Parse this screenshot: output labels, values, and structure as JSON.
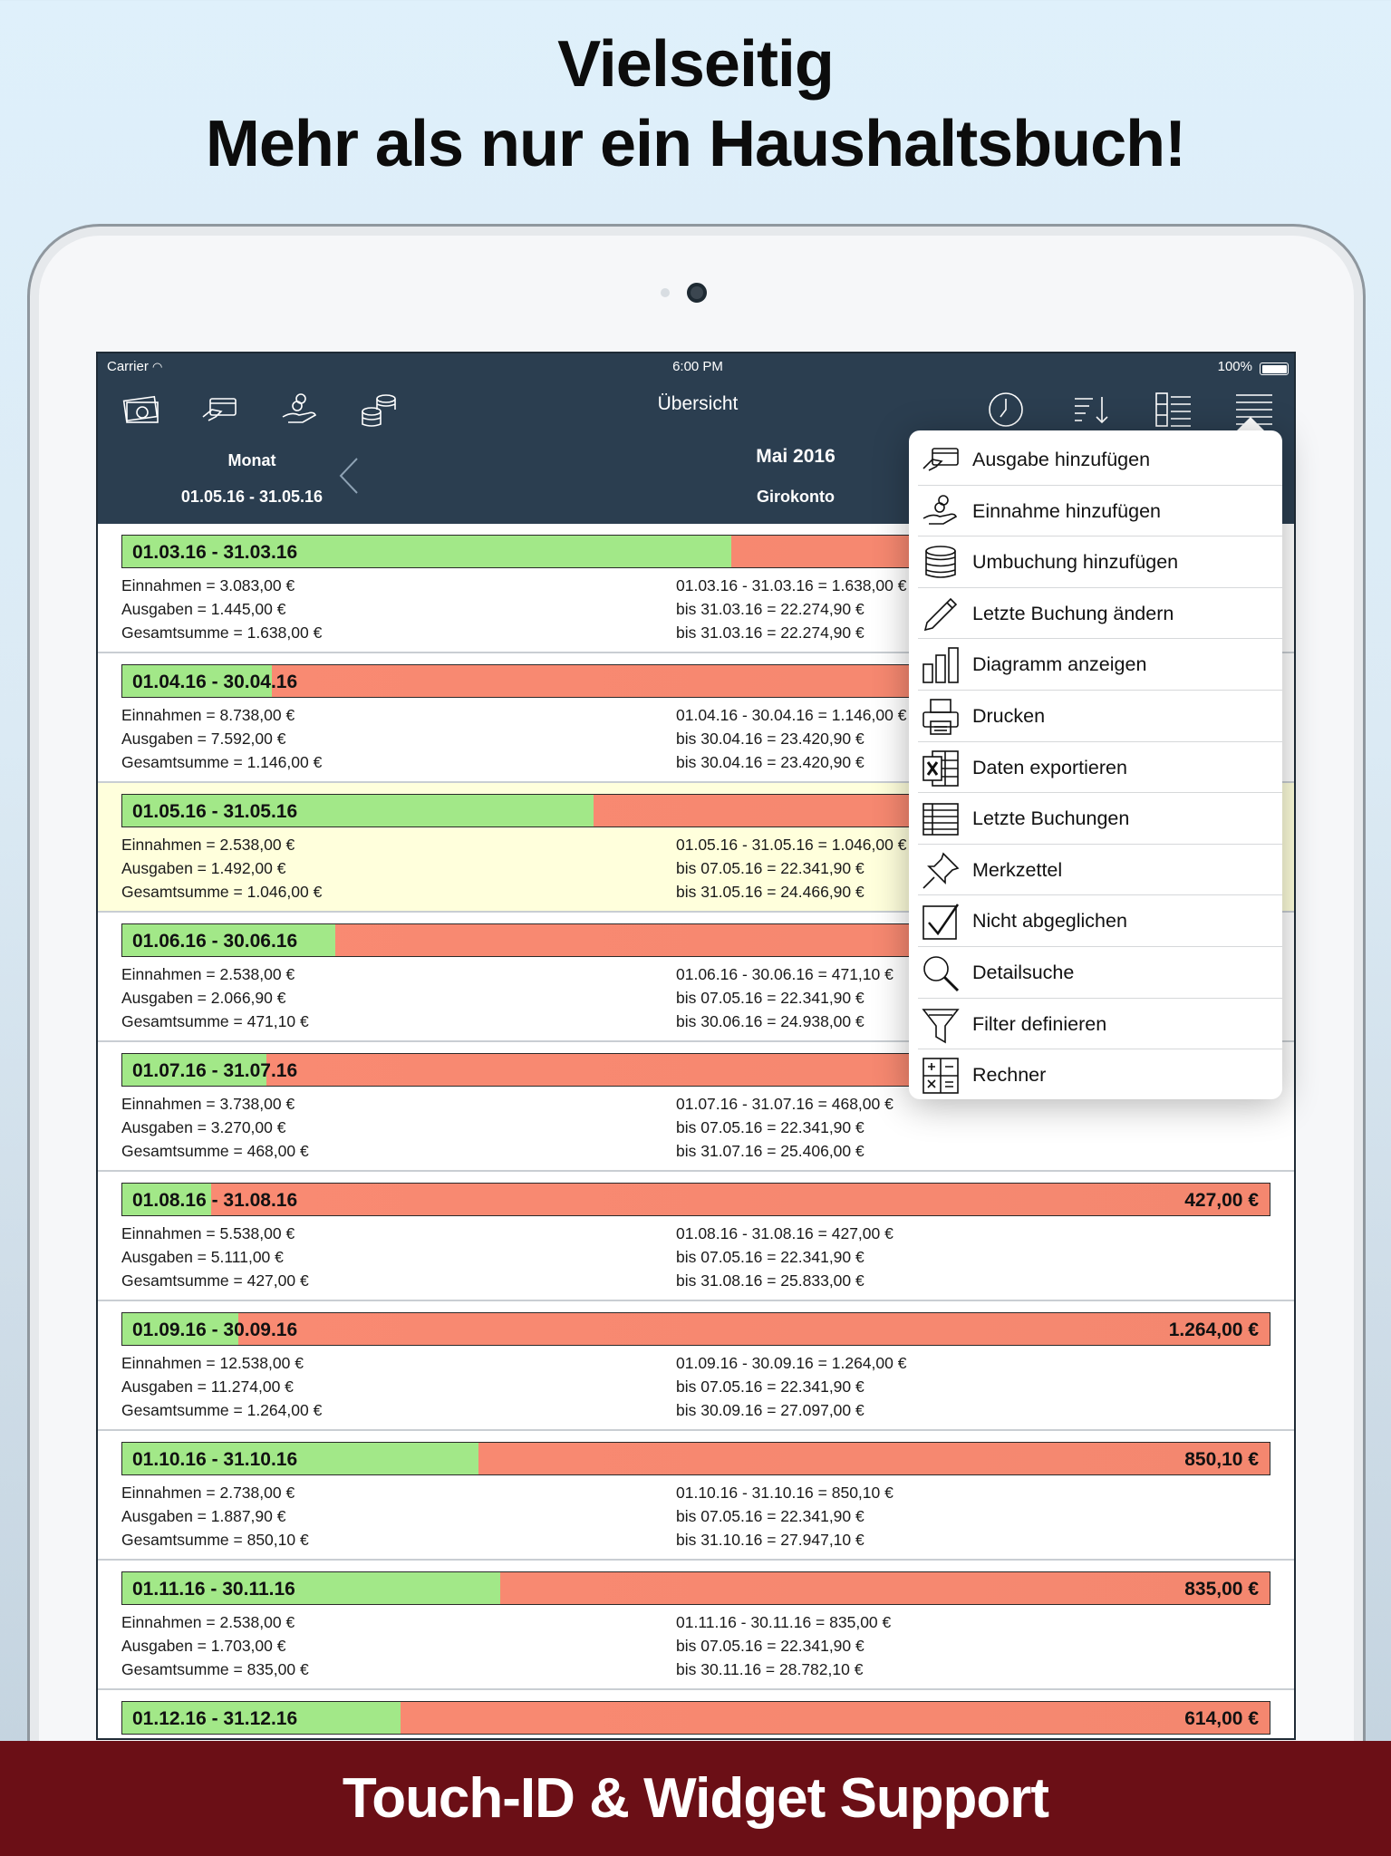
{
  "headline": {
    "line1": "Vielseitig",
    "line2": "Mehr als nur ein Haushaltsbuch!"
  },
  "status_bar": {
    "carrier": "Carrier",
    "time": "6:00 PM",
    "battery": "100%"
  },
  "nav": {
    "title": "Übersicht",
    "left_icons": [
      "money-icon",
      "card-payment-icon",
      "income-hand-icon",
      "coins-stack-icon"
    ],
    "right_icons": [
      "clock-icon",
      "sort-icon",
      "list-detail-icon",
      "menu-icon"
    ]
  },
  "header": {
    "mode": "Monat",
    "range": "01.05.16 - 31.05.16",
    "period": "Mai 2016",
    "account": "Girokonto"
  },
  "rows": [
    {
      "range": "01.03.16 - 31.03.16",
      "green_ratio": 0.53,
      "amount": "",
      "selected": false,
      "einnahmen": "Einnahmen = 3.083,00 €",
      "ausgaben": "Ausgaben = 1.445,00 €",
      "gesamt": "Gesamtsumme = 1.638,00 €",
      "r1": "01.03.16 - 31.03.16 = 1.638,00 €",
      "r2": "bis 31.03.16 = 22.274,90 €",
      "r3": "bis 31.03.16 = 22.274,90 €"
    },
    {
      "range": "01.04.16 - 30.04.16",
      "green_ratio": 0.13,
      "amount": "",
      "selected": false,
      "einnahmen": "Einnahmen = 8.738,00 €",
      "ausgaben": "Ausgaben = 7.592,00 €",
      "gesamt": "Gesamtsumme = 1.146,00 €",
      "r1": "01.04.16 - 30.04.16 = 1.146,00 €",
      "r2": "bis 30.04.16 = 23.420,90 €",
      "r3": "bis 30.04.16 = 23.420,90 €"
    },
    {
      "range": "01.05.16 - 31.05.16",
      "green_ratio": 0.41,
      "amount": "",
      "selected": true,
      "einnahmen": "Einnahmen = 2.538,00 €",
      "ausgaben": "Ausgaben = 1.492,00 €",
      "gesamt": "Gesamtsumme = 1.046,00 €",
      "r1": "01.05.16 - 31.05.16 = 1.046,00 €",
      "r2": "bis 07.05.16 = 22.341,90 €",
      "r3": "bis 31.05.16 = 24.466,90 €"
    },
    {
      "range": "01.06.16 - 30.06.16",
      "green_ratio": 0.185,
      "amount": "",
      "selected": false,
      "einnahmen": "Einnahmen = 2.538,00 €",
      "ausgaben": "Ausgaben = 2.066,90 €",
      "gesamt": "Gesamtsumme = 471,10 €",
      "r1": "01.06.16 - 30.06.16 = 471,10 €",
      "r2": "bis 07.05.16 = 22.341,90 €",
      "r3": "bis 30.06.16 = 24.938,00 €"
    },
    {
      "range": "01.07.16 - 31.07.16",
      "green_ratio": 0.125,
      "amount": "",
      "selected": false,
      "einnahmen": "Einnahmen = 3.738,00 €",
      "ausgaben": "Ausgaben = 3.270,00 €",
      "gesamt": "Gesamtsumme = 468,00 €",
      "r1": "01.07.16 - 31.07.16 = 468,00 €",
      "r2": "bis 07.05.16 = 22.341,90 €",
      "r3": "bis 31.07.16 = 25.406,00 €"
    },
    {
      "range": "01.08.16 - 31.08.16",
      "green_ratio": 0.077,
      "amount": "427,00 €",
      "selected": false,
      "einnahmen": "Einnahmen = 5.538,00 €",
      "ausgaben": "Ausgaben = 5.111,00 €",
      "gesamt": "Gesamtsumme = 427,00 €",
      "r1": "01.08.16 - 31.08.16 = 427,00 €",
      "r2": "bis 07.05.16 = 22.341,90 €",
      "r3": "bis 31.08.16 = 25.833,00 €"
    },
    {
      "range": "01.09.16 - 30.09.16",
      "green_ratio": 0.101,
      "amount": "1.264,00 €",
      "selected": false,
      "einnahmen": "Einnahmen = 12.538,00 €",
      "ausgaben": "Ausgaben = 11.274,00 €",
      "gesamt": "Gesamtsumme = 1.264,00 €",
      "r1": "01.09.16 - 30.09.16 = 1.264,00 €",
      "r2": "bis 07.05.16 = 22.341,90 €",
      "r3": "bis 30.09.16 = 27.097,00 €"
    },
    {
      "range": "01.10.16 - 31.10.16",
      "green_ratio": 0.31,
      "amount": "850,10 €",
      "selected": false,
      "einnahmen": "Einnahmen = 2.738,00 €",
      "ausgaben": "Ausgaben = 1.887,90 €",
      "gesamt": "Gesamtsumme = 850,10 €",
      "r1": "01.10.16 - 31.10.16 = 850,10 €",
      "r2": "bis 07.05.16 = 22.341,90 €",
      "r3": "bis 31.10.16 = 27.947,10 €"
    },
    {
      "range": "01.11.16 - 30.11.16",
      "green_ratio": 0.329,
      "amount": "835,00 €",
      "selected": false,
      "einnahmen": "Einnahmen = 2.538,00 €",
      "ausgaben": "Ausgaben = 1.703,00 €",
      "gesamt": "Gesamtsumme = 835,00 €",
      "r1": "01.11.16 - 30.11.16 = 835,00 €",
      "r2": "bis 07.05.16 = 22.341,90 €",
      "r3": "bis 30.11.16 = 28.782,10 €"
    },
    {
      "range": "01.12.16 - 31.12.16",
      "green_ratio": 0.242,
      "amount": "614,00 €",
      "selected": false,
      "einnahmen": "",
      "ausgaben": "",
      "gesamt": "",
      "r1": "",
      "r2": "",
      "r3": ""
    }
  ],
  "menu": [
    {
      "label": "Ausgabe hinzufügen",
      "icon": "card-payment-icon"
    },
    {
      "label": "Einnahme hinzufügen",
      "icon": "income-hand-icon"
    },
    {
      "label": "Umbuchung hinzufügen",
      "icon": "coins-stack-icon"
    },
    {
      "label": "Letzte Buchung ändern",
      "icon": "pencil-icon"
    },
    {
      "label": "Diagramm anzeigen",
      "icon": "bar-chart-icon"
    },
    {
      "label": "Drucken",
      "icon": "printer-icon"
    },
    {
      "label": "Daten exportieren",
      "icon": "excel-icon"
    },
    {
      "label": "Letzte Buchungen",
      "icon": "table-icon"
    },
    {
      "label": "Merkzettel",
      "icon": "pin-icon"
    },
    {
      "label": "Nicht abgeglichen",
      "icon": "checkbox-icon"
    },
    {
      "label": "Detailsuche",
      "icon": "search-icon"
    },
    {
      "label": "Filter definieren",
      "icon": "filter-icon"
    },
    {
      "label": "Rechner",
      "icon": "calculator-icon"
    }
  ],
  "footer": {
    "text": "Touch-ID & Widget Support"
  },
  "colors": {
    "navbar": "#2b3e50",
    "income_green": "#a2e888",
    "expense_red": "#fa8a72",
    "selected_row": "#ffffdc",
    "footer": "#6b0f16"
  }
}
